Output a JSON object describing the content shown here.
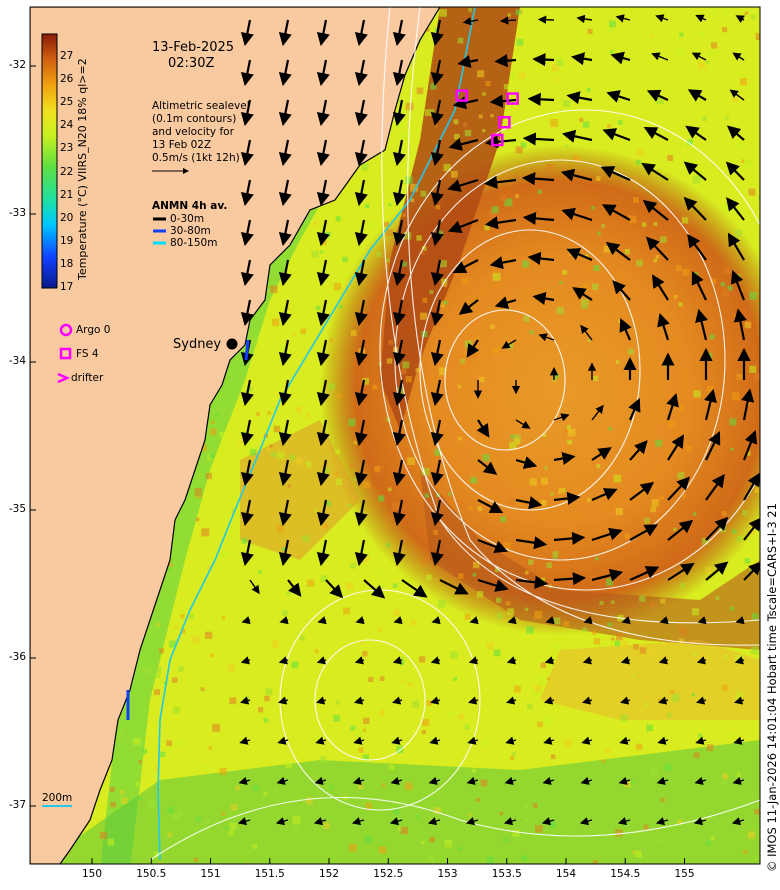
{
  "title": {
    "date": "13-Feb-2025",
    "time": "02:30Z"
  },
  "altimetry_note": [
    "Altimetric sealevel",
    "(0.1m contours)",
    "and velocity for",
    "13 Feb 02Z",
    "0.5m/s (1kt 12h)"
  ],
  "anmn": {
    "heading": "ANMN 4h av.",
    "items": [
      {
        "label": "0-30m",
        "color": "#000000"
      },
      {
        "label": "30-80m",
        "color": "#1040ff"
      },
      {
        "label": "80-150m",
        "color": "#00e0ff"
      }
    ]
  },
  "legend": [
    {
      "label": "Argo 0",
      "icon": "circle-icon",
      "color": "#ff00ff"
    },
    {
      "label": "FS 4",
      "icon": "square-icon",
      "color": "#ff00ff"
    },
    {
      "label": "drifter",
      "icon": "chevron-icon",
      "color": "#ff00ff"
    }
  ],
  "colorbar": {
    "label": "Temperature (°C) VIIRS_N20 18% ql>=2",
    "min": 17,
    "max": 28,
    "ticks": [
      "27",
      "26",
      "25",
      "24",
      "23",
      "22",
      "21",
      "20",
      "19",
      "18",
      "17"
    ]
  },
  "axes": {
    "lat_ticks": [
      "-32",
      "-33",
      "-34",
      "-35",
      "-36",
      "-37"
    ],
    "lon_ticks": [
      "150",
      "150.5",
      "151",
      "151.5",
      "152",
      "152.5",
      "153",
      "153.5",
      "154",
      "154.5",
      "155"
    ]
  },
  "place": {
    "name": "Sydney"
  },
  "scale_note": "200m",
  "credit": "© IMOS 11-Jan-2026 14:01:04 Hobart time Tscale=CARS+I-3 21",
  "colors": {
    "land": "#f9c9a0",
    "drifter": "#ff00ff",
    "isobath": "#22c8e8"
  },
  "floats": [
    {
      "type": "FS",
      "lon": 153.12,
      "lat": -32.2
    },
    {
      "type": "FS",
      "lon": 153.55,
      "lat": -32.22
    },
    {
      "type": "FS",
      "lon": 153.48,
      "lat": -32.38
    },
    {
      "type": "FS",
      "lon": 153.42,
      "lat": -32.5
    }
  ]
}
